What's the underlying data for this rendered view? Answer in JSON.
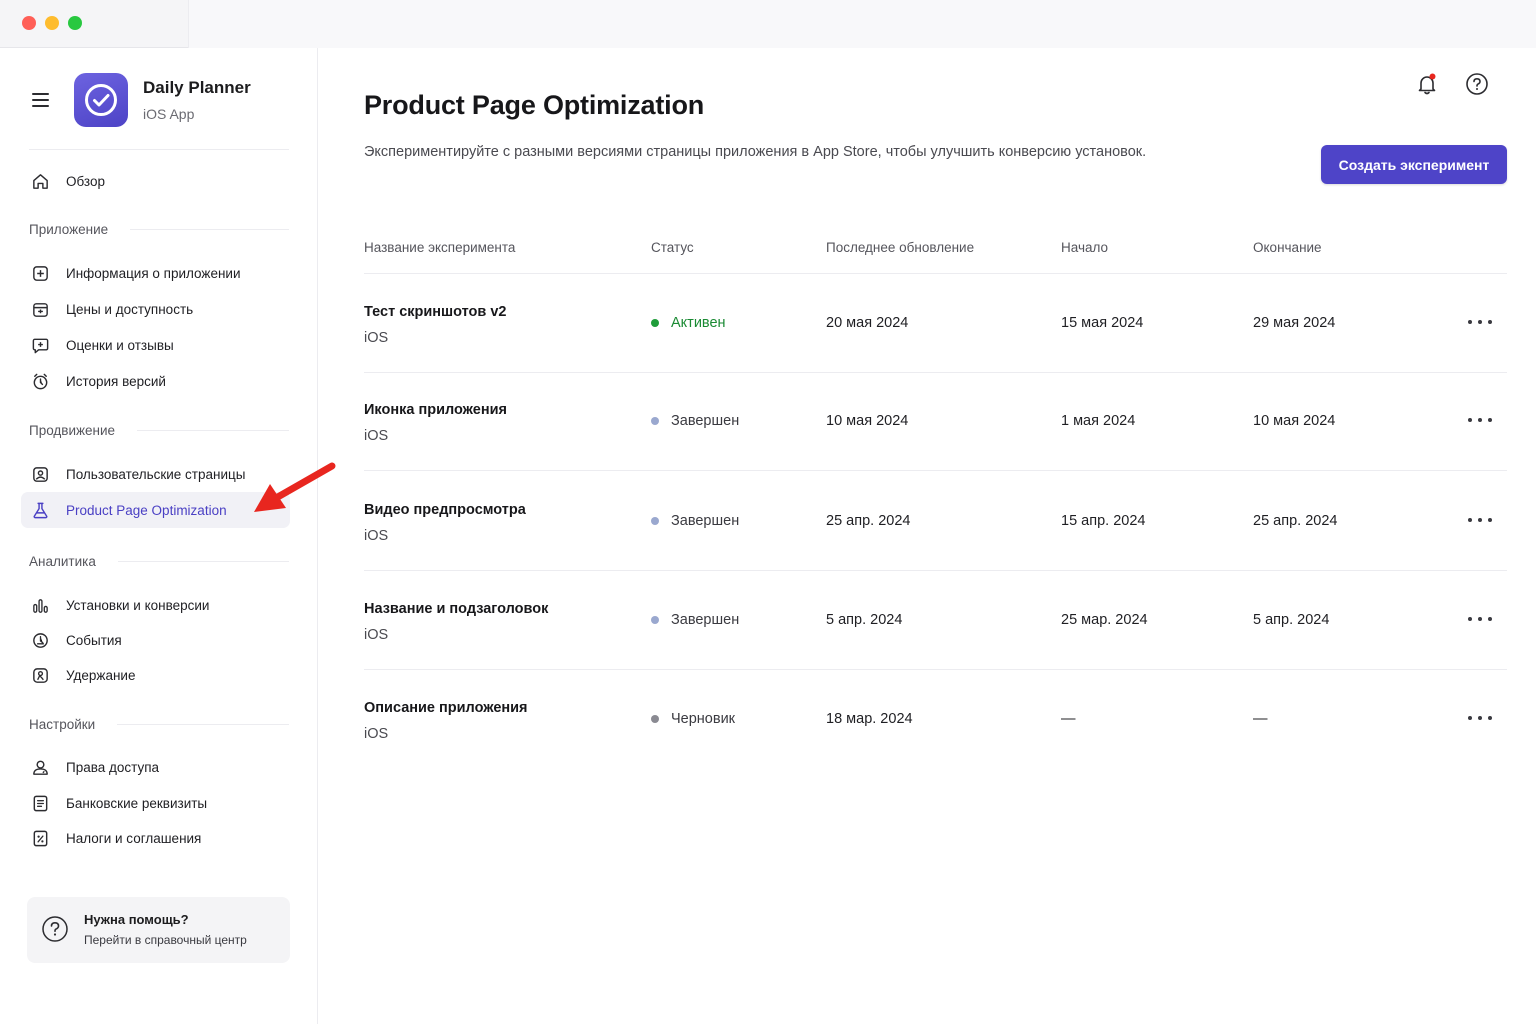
{
  "app": {
    "name": "Daily Planner",
    "platform": "iOS App"
  },
  "sidebar": {
    "overview": {
      "label": "Обзор",
      "icon": "home-icon"
    },
    "sections": [
      {
        "title": "Приложение",
        "items": [
          {
            "label": "Информация о приложении",
            "icon": "plus-square-icon"
          },
          {
            "label": "Цены и доступность",
            "icon": "price-tag-icon"
          },
          {
            "label": "Оценки и отзывы",
            "icon": "review-icon"
          },
          {
            "label": "История версий",
            "icon": "clock-icon"
          }
        ]
      },
      {
        "title": "Продвижение",
        "items": [
          {
            "label": "Пользовательские страницы",
            "icon": "page-icon"
          },
          {
            "label": "Product Page Optimization",
            "icon": "flask-icon",
            "active": true
          }
        ]
      },
      {
        "title": "Аналитика",
        "items": [
          {
            "label": "Установки и конверсии",
            "icon": "bar-chart-icon"
          },
          {
            "label": "События",
            "icon": "events-icon"
          },
          {
            "label": "Удержание",
            "icon": "retention-icon"
          }
        ]
      },
      {
        "title": "Настройки",
        "items": [
          {
            "label": "Права доступа",
            "icon": "users-icon"
          },
          {
            "label": "Банковские реквизиты",
            "icon": "bank-icon"
          },
          {
            "label": "Налоги и соглашения",
            "icon": "tax-icon"
          }
        ]
      }
    ],
    "help": {
      "title": "Нужна помощь?",
      "subtitle": "Перейти в справочный центр"
    }
  },
  "main": {
    "title": "Product Page Optimization",
    "description": "Экспериментируйте с разными версиями страницы приложения в App Store, чтобы улучшить конверсию установок.",
    "create_button": "Создать эксперимент",
    "columns": {
      "name": "Название эксперимента",
      "status": "Статус",
      "updated": "Последнее обновление",
      "start": "Начало",
      "end": "Окончание"
    },
    "rows": [
      {
        "name": "Тест скриншотов v2",
        "platform": "iOS",
        "status": "Активен",
        "status_color": "#1f9d3a",
        "status_text_color": "#1a8a33",
        "updated": "20 мая 2024",
        "start": "15 мая 2024",
        "end": "29 мая 2024"
      },
      {
        "name": "Иконка приложения",
        "platform": "iOS",
        "status": "Завершен",
        "status_color": "#9aa8cf",
        "status_text_color": "#3a3a40",
        "updated": "10 мая 2024",
        "start": "1 мая 2024",
        "end": "10 мая 2024"
      },
      {
        "name": "Видео предпросмотра",
        "platform": "iOS",
        "status": "Завершен",
        "status_color": "#9aa8cf",
        "status_text_color": "#3a3a40",
        "updated": "25 апр. 2024",
        "start": "15 апр. 2024",
        "end": "25 апр. 2024"
      },
      {
        "name": "Название и подзаголовок",
        "platform": "iOS",
        "status": "Завершен",
        "status_color": "#9aa8cf",
        "status_text_color": "#3a3a40",
        "updated": "5 апр. 2024",
        "start": "25 мар. 2024",
        "end": "5 апр. 2024"
      },
      {
        "name": "Описание приложения",
        "platform": "iOS",
        "status": "Черновик",
        "status_color": "#8a8a92",
        "status_text_color": "#3a3a40",
        "updated": "18 мар. 2024",
        "start": "—",
        "end": "—"
      }
    ]
  },
  "colors": {
    "accent": "#4e44c8",
    "annotation_arrow": "#e8261f"
  }
}
